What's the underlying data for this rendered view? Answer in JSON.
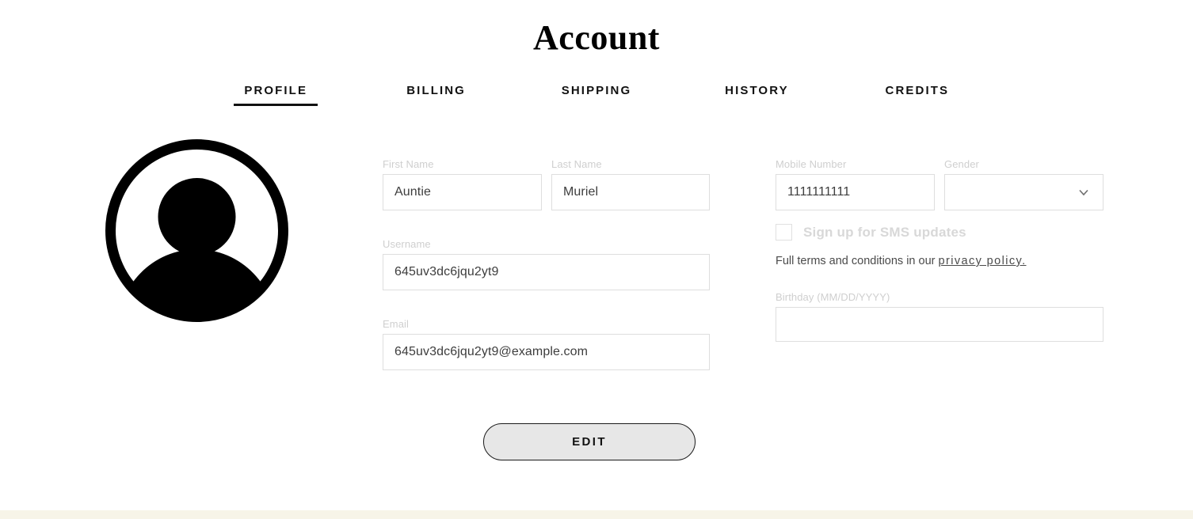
{
  "page": {
    "title": "Account",
    "background_color": "#ffffff",
    "accent_color": "#111111",
    "bottom_band_color": "#f7f4e8"
  },
  "tabs": [
    {
      "label": "PROFILE",
      "active": true
    },
    {
      "label": "BILLING",
      "active": false
    },
    {
      "label": "SHIPPING",
      "active": false
    },
    {
      "label": "HISTORY",
      "active": false
    },
    {
      "label": "CREDITS",
      "active": false
    }
  ],
  "avatar": {
    "icon": "person-avatar-icon",
    "color": "#000000"
  },
  "form": {
    "first_name": {
      "label": "First Name",
      "value": "Auntie"
    },
    "last_name": {
      "label": "Last Name",
      "value": "Muriel"
    },
    "username": {
      "label": "Username",
      "value": "645uv3dc6jqu2yt9"
    },
    "email": {
      "label": "Email",
      "value": "645uv3dc6jqu2yt9@example.com"
    },
    "mobile_number": {
      "label": "Mobile Number",
      "value": "1111111111"
    },
    "gender": {
      "label": "Gender",
      "value": "",
      "icon": "chevron-down-icon"
    },
    "birthday": {
      "label": "Birthday (MM/DD/YYYY)",
      "value": ""
    }
  },
  "sms": {
    "checked": false,
    "label": "Sign up for SMS updates",
    "terms_prefix": "Full terms and conditions in our ",
    "terms_link": "privacy policy."
  },
  "actions": {
    "edit_label": "EDIT"
  }
}
